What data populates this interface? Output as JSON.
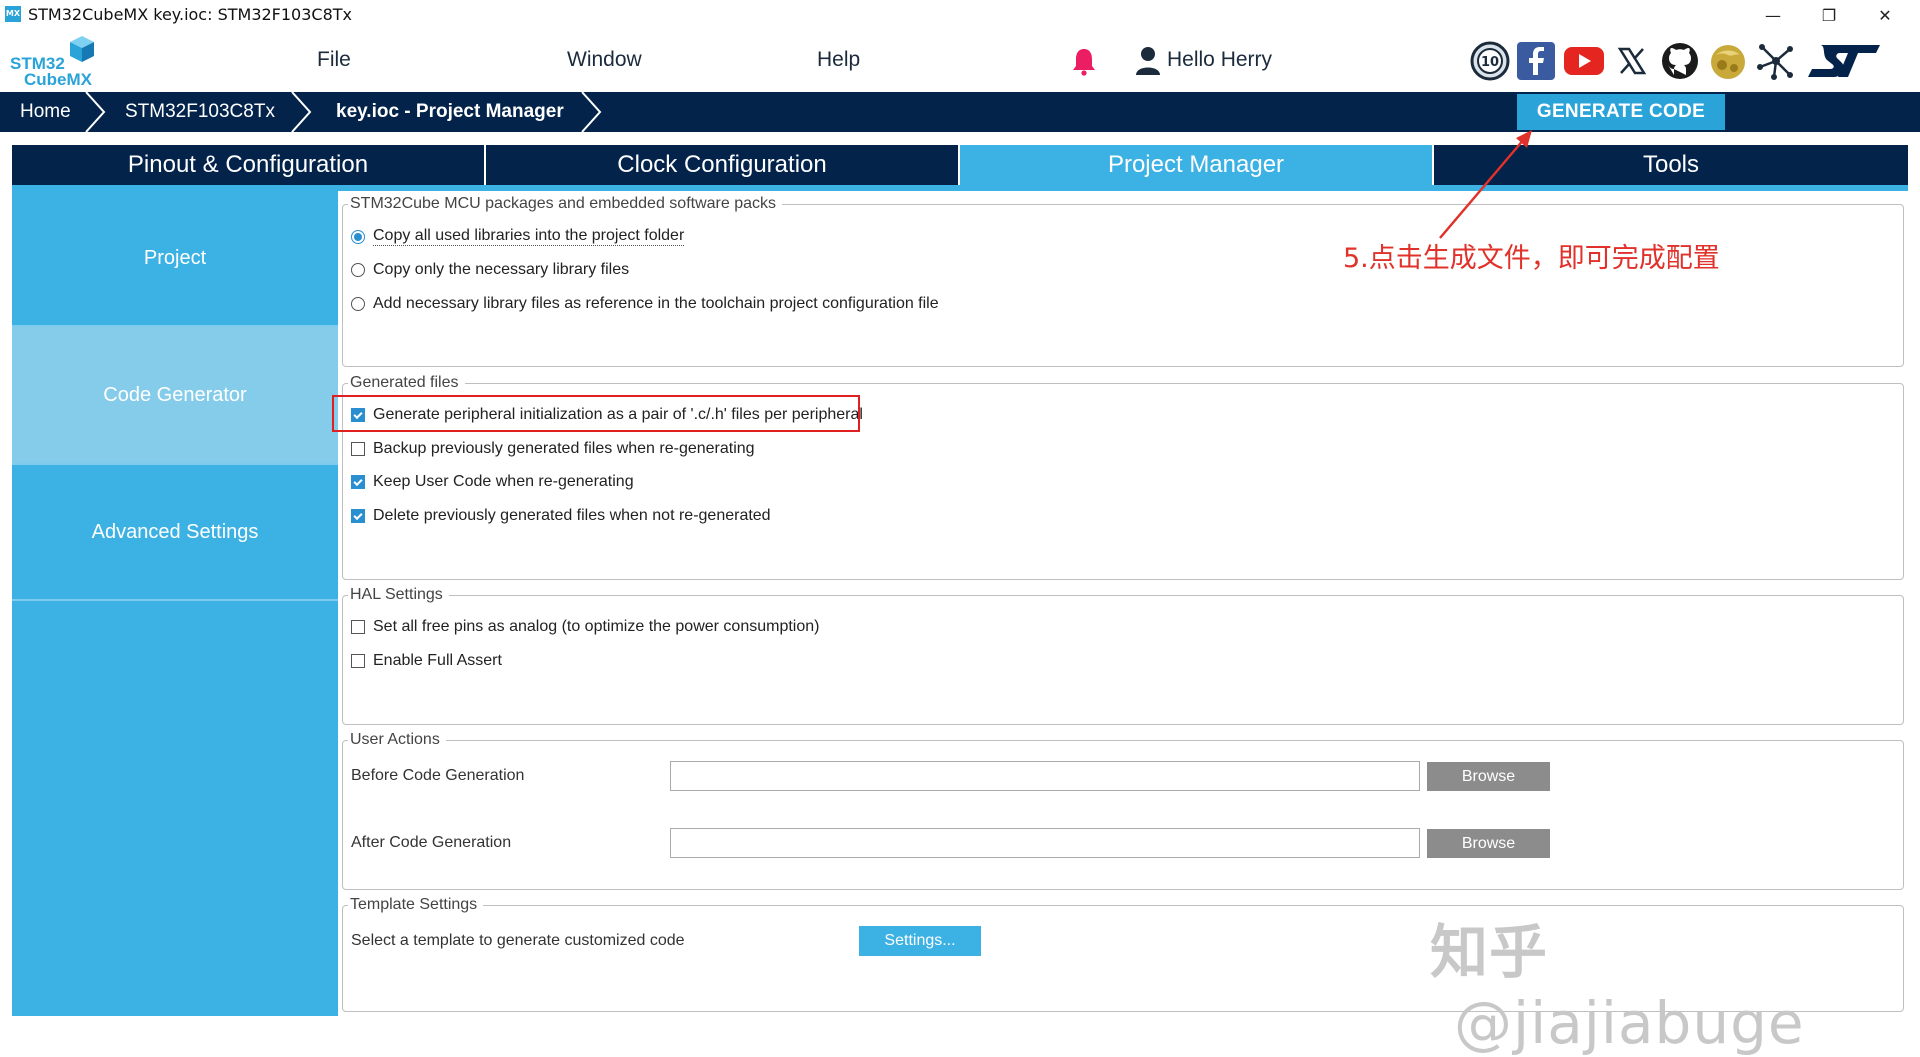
{
  "window": {
    "icon_text": "MX",
    "title": "STM32CubeMX key.ioc: STM32F103C8Tx",
    "minimize": "—",
    "restore": "❐",
    "close": "✕"
  },
  "logo": {
    "line1": "STM32",
    "line2": "CubeMX"
  },
  "menu": {
    "file": "File",
    "window": "Window",
    "help": "Help"
  },
  "user": {
    "greeting": "Hello Herry"
  },
  "social_icons": [
    "anniversary-10-icon",
    "facebook-icon",
    "youtube-icon",
    "x-icon",
    "github-icon",
    "community-icon",
    "network-icon",
    "st-logo-icon"
  ],
  "breadcrumb": {
    "home": "Home",
    "mcu": "STM32F103C8Tx",
    "project": "key.ioc - Project Manager"
  },
  "generate_code": "GENERATE CODE",
  "tabs": [
    {
      "label": "Pinout & Configuration",
      "active": false
    },
    {
      "label": "Clock Configuration",
      "active": false
    },
    {
      "label": "Project Manager",
      "active": true
    },
    {
      "label": "Tools",
      "active": false
    }
  ],
  "sidebar": {
    "items": [
      {
        "label": "Project",
        "active": false
      },
      {
        "label": "Code Generator",
        "active": true
      },
      {
        "label": "Advanced Settings",
        "active": false
      }
    ]
  },
  "mcu_packages": {
    "legend": "STM32Cube MCU packages and embedded software packs",
    "options": [
      {
        "label": "Copy all used libraries into the project folder",
        "selected": true
      },
      {
        "label": "Copy only the necessary library files",
        "selected": false
      },
      {
        "label": "Add necessary library files as reference in the toolchain project configuration file",
        "selected": false
      }
    ]
  },
  "generated_files": {
    "legend": "Generated files",
    "options": [
      {
        "label": "Generate peripheral initialization as a pair of '.c/.h' files per peripheral",
        "checked": true
      },
      {
        "label": "Backup previously generated files when re-generating",
        "checked": false
      },
      {
        "label": "Keep User Code when re-generating",
        "checked": true
      },
      {
        "label": "Delete previously generated files when not re-generated",
        "checked": true
      }
    ]
  },
  "hal_settings": {
    "legend": "HAL Settings",
    "options": [
      {
        "label": "Set all free pins as analog (to optimize the power consumption)",
        "checked": false
      },
      {
        "label": "Enable Full Assert",
        "checked": false
      }
    ]
  },
  "user_actions": {
    "legend": "User Actions",
    "before_label": "Before Code Generation",
    "before_value": "",
    "after_label": "After Code Generation",
    "after_value": "",
    "browse": "Browse"
  },
  "template_settings": {
    "legend": "Template Settings",
    "label": "Select a template to generate customized code",
    "button": "Settings..."
  },
  "annotation": {
    "text": "5.点击生成文件，即可完成配置",
    "color": "#e0312a"
  },
  "watermark": {
    "site": "知乎",
    "handle": "@jiajiabuge"
  },
  "colors": {
    "navy": "#03234b",
    "accent": "#3cb1e3",
    "sidebar_active": "#85cceb",
    "check": "#2a8fd0"
  }
}
